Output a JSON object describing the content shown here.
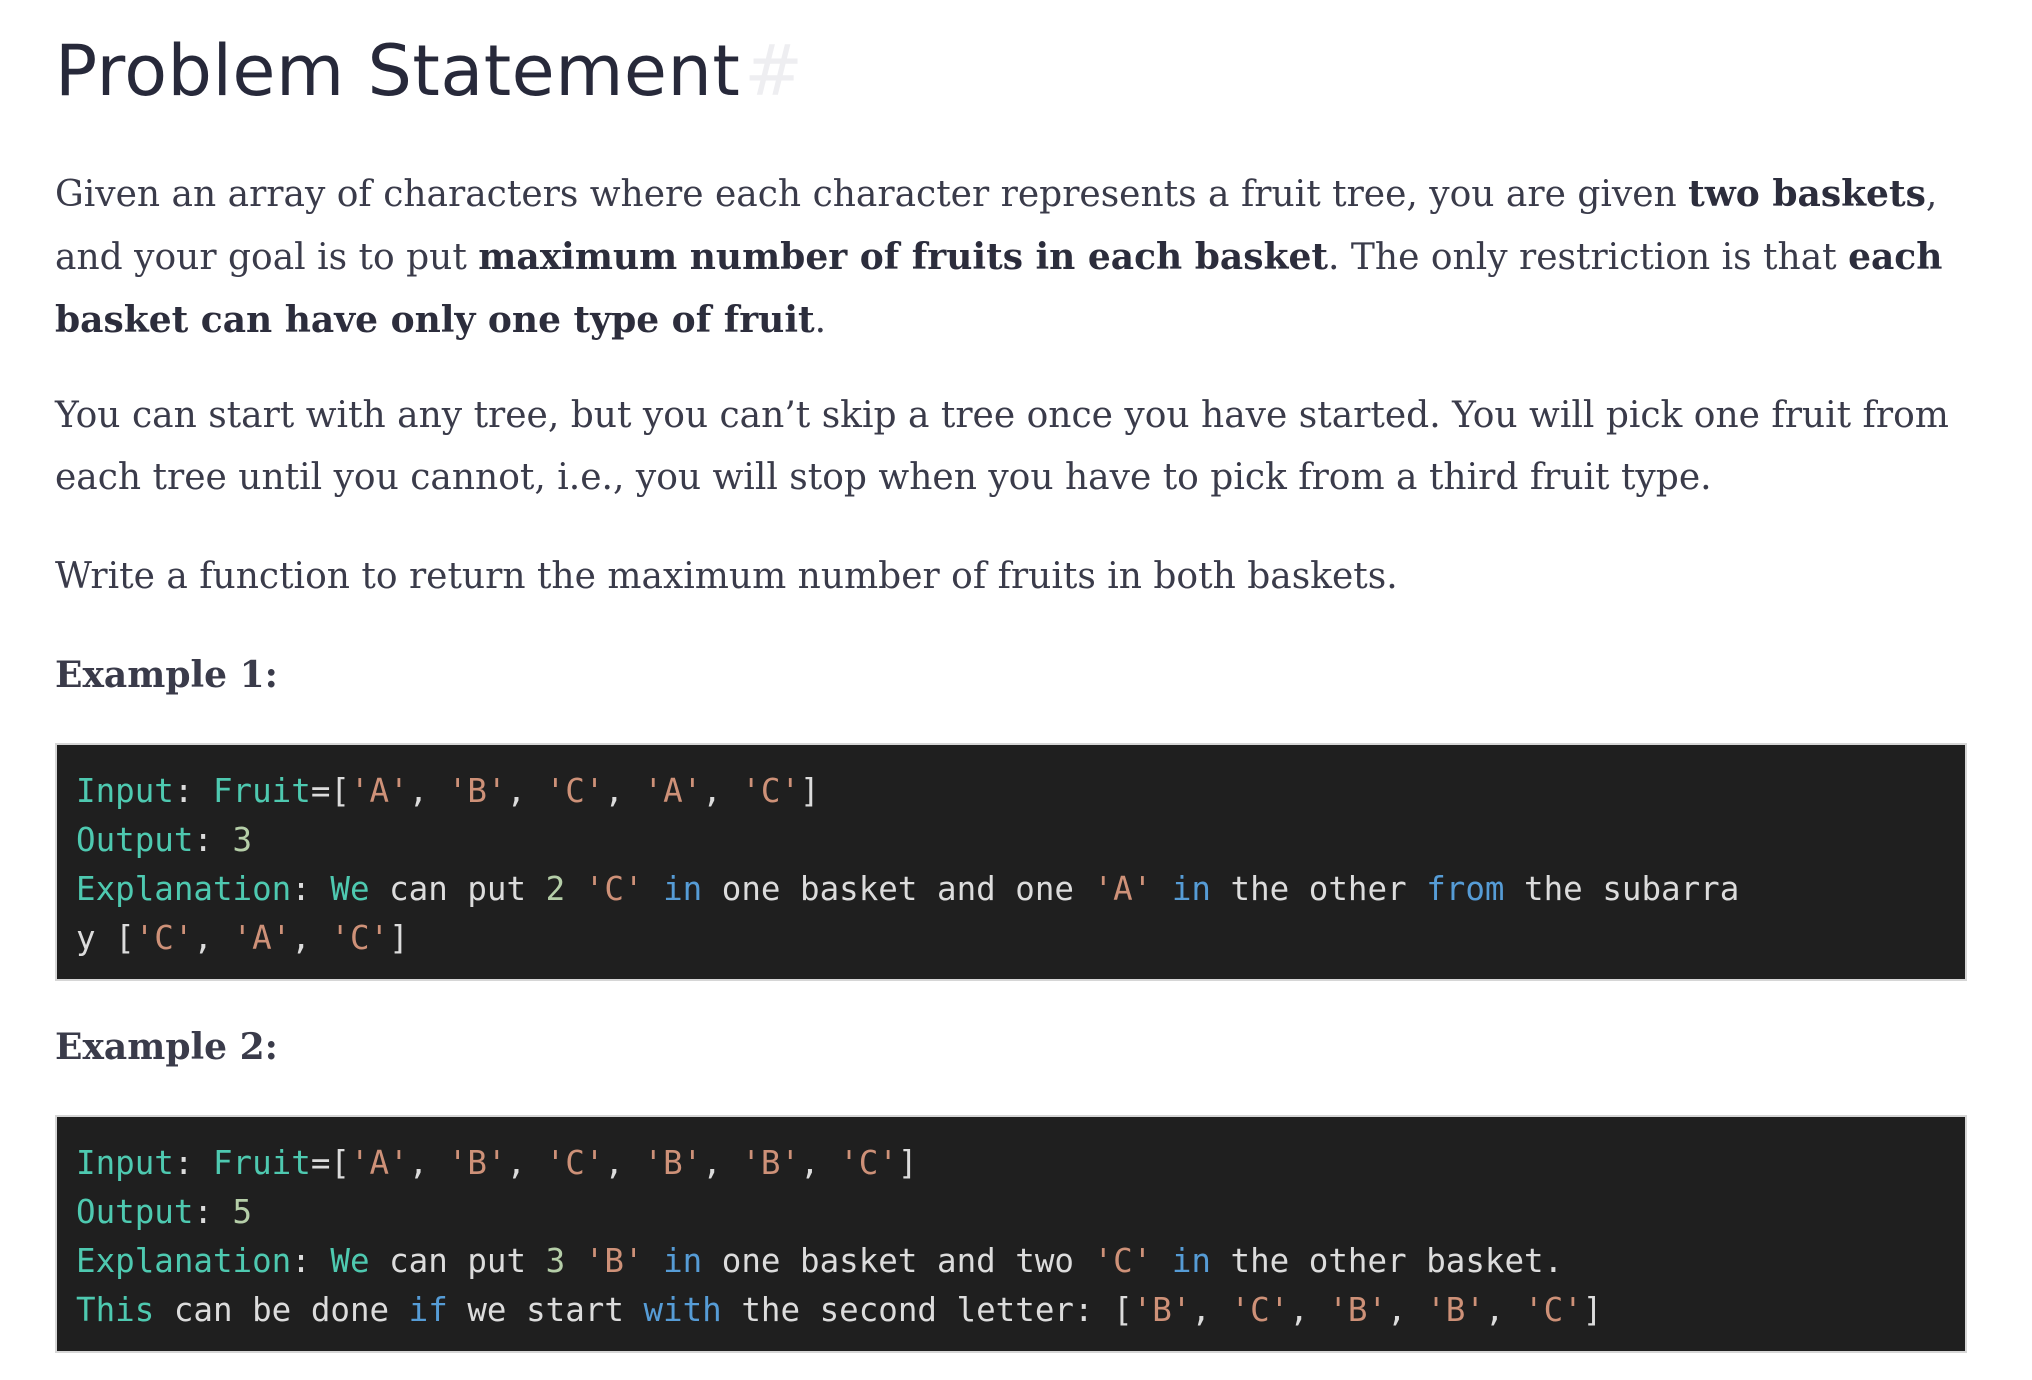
{
  "heading": {
    "title": "Problem Statement",
    "anchor": "#"
  },
  "paragraphs": {
    "p1": {
      "t1": "Given an array of characters where each character represents a fruit tree, you are given ",
      "b1": "two baskets",
      "t2": ", and your goal is to put ",
      "b2": "maximum number of fruits in each basket",
      "t3": ". The only restriction is that ",
      "b3": "each basket can have only one type of fruit",
      "t4": "."
    },
    "p2": "You can start with any tree, but you can’t skip a tree once you have started. You will pick one fruit from each tree until you cannot, i.e., you will stop when you have to pick from a third fruit type.",
    "p3": "Write a function to return the maximum number of fruits in both baskets."
  },
  "examples": {
    "ex1": {
      "heading": "Example 1:",
      "line1": {
        "k1": "Input",
        "c1": ": ",
        "k2": "Fruit",
        "c2": "=[",
        "s1": "'A'",
        "c3": ", ",
        "s2": "'B'",
        "c4": ", ",
        "s3": "'C'",
        "c5": ", ",
        "s4": "'A'",
        "c6": ", ",
        "s5": "'C'",
        "c7": "]"
      },
      "line2": {
        "k1": "Output",
        "c1": ": ",
        "n1": "3"
      },
      "line3": {
        "k1": "Explanation",
        "c1": ": ",
        "k2": "We",
        "t1": " can put ",
        "n1": "2",
        "t2": " ",
        "s1": "'C'",
        "t3": " ",
        "b1": "in",
        "t4": " one basket and one ",
        "s2": "'A'",
        "t5": " ",
        "b2": "in",
        "t6": " the other ",
        "b3": "from",
        "t7": " the subarra"
      },
      "line4": {
        "t1": "y [",
        "s1": "'C'",
        "c1": ", ",
        "s2": "'A'",
        "c2": ", ",
        "s3": "'C'",
        "c3": "]"
      }
    },
    "ex2": {
      "heading": "Example 2:",
      "line1": {
        "k1": "Input",
        "c1": ": ",
        "k2": "Fruit",
        "c2": "=[",
        "s1": "'A'",
        "c3": ", ",
        "s2": "'B'",
        "c4": ", ",
        "s3": "'C'",
        "c5": ", ",
        "s4": "'B'",
        "c6": ", ",
        "s5": "'B'",
        "c7": ", ",
        "s6": "'C'",
        "c8": "]"
      },
      "line2": {
        "k1": "Output",
        "c1": ": ",
        "n1": "5"
      },
      "line3": {
        "k1": "Explanation",
        "c1": ": ",
        "k2": "We",
        "t1": " can put ",
        "n1": "3",
        "t2": " ",
        "s1": "'B'",
        "t3": " ",
        "b1": "in",
        "t4": " one basket and two ",
        "s2": "'C'",
        "t5": " ",
        "b2": "in",
        "t6": " the other basket."
      },
      "line4": {
        "k1": "This",
        "t1": " can be done ",
        "b1": "if",
        "t2": " we start ",
        "b2": "with",
        "t3": " the second letter: [",
        "s1": "'B'",
        "c1": ", ",
        "s2": "'C'",
        "c2": ", ",
        "s3": "'B'",
        "c3": ", ",
        "s4": "'B'",
        "c4": ", ",
        "s5": "'C'",
        "c5": "]"
      }
    }
  },
  "colors": {
    "code_bg": "#1f1f1f",
    "keyword_teal": "#4ec9b0",
    "string": "#ce9178",
    "number": "#b5cea8",
    "keyword_blue": "#569cd6",
    "text": "#3a3b4a"
  }
}
